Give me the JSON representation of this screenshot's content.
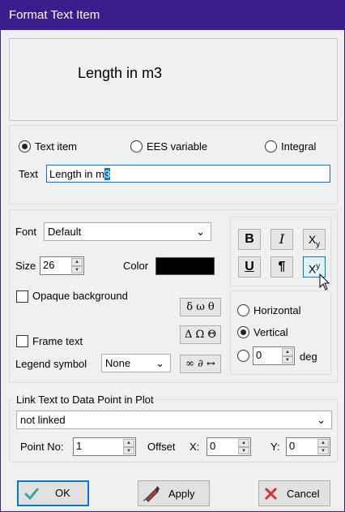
{
  "window": {
    "title": "Format Text Item"
  },
  "preview": {
    "text": "Length in m3"
  },
  "text_source": {
    "options": [
      {
        "label": "Text item",
        "selected": true
      },
      {
        "label": "EES variable",
        "selected": false
      },
      {
        "label": "Integral",
        "selected": false
      }
    ],
    "text_label": "Text",
    "text_before_cursor": "Length in m",
    "text_selected": "3"
  },
  "font": {
    "font_label": "Font",
    "font_value": "Default",
    "size_label": "Size",
    "size_value": "26",
    "color_label": "Color",
    "color_value": "#000000",
    "opaque_label": "Opaque background",
    "opaque_checked": false,
    "frame_label": "Frame text",
    "frame_checked": false,
    "legend_label": "Legend symbol",
    "legend_value": "None"
  },
  "format_buttons": {
    "bold": "B",
    "italic": "I",
    "subscript_base": "X",
    "subscript_sub": "y",
    "underline": "U",
    "paragraph": "¶",
    "superscript_base": "X",
    "superscript_sup": "y"
  },
  "symbols": {
    "lower_greek": "δ ω θ",
    "upper_greek": "Δ Ω Θ",
    "math": "∞ ∂ ↔"
  },
  "orientation": {
    "horizontal_label": "Horizontal",
    "vertical_label": "Vertical",
    "selected": "Vertical",
    "angle_value": "0",
    "deg_label": "deg"
  },
  "link": {
    "group_label": "Link Text to Data Point in Plot",
    "link_value": "not linked",
    "point_label": "Point No:",
    "point_value": "1",
    "offset_label": "Offset",
    "x_label": "X:",
    "x_value": "0",
    "y_label": "Y:",
    "y_value": "0"
  },
  "buttons": {
    "ok": "OK",
    "apply": "Apply",
    "cancel": "Cancel"
  },
  "icons": {
    "ok": "checkmark-icon",
    "apply": "pen-icon",
    "cancel": "x-icon",
    "cursor": "mouse-pointer-icon"
  }
}
